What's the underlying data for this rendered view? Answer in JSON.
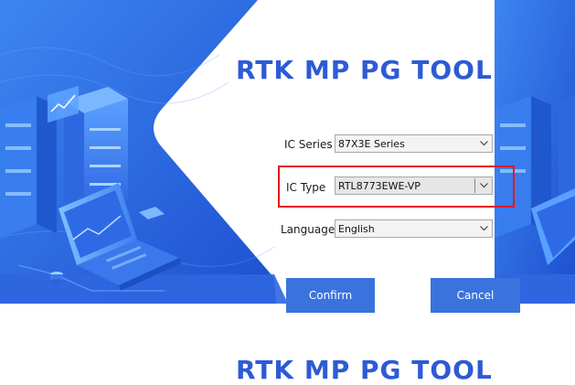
{
  "window": {
    "title": "RTK MP PG TOOL",
    "title_repeat": "RTK MP PG TOOL"
  },
  "form": {
    "ic_series": {
      "label": "IC Series",
      "value": "87X3E Series"
    },
    "ic_type": {
      "label": "IC Type",
      "value": "RTL8773EWE-VP"
    },
    "language": {
      "label": "Language",
      "value": "English"
    }
  },
  "buttons": {
    "confirm": "Confirm",
    "cancel": "Cancel"
  },
  "colors": {
    "accent": "#2d5bd6",
    "button": "#3a73de",
    "highlight": "#e3191b"
  }
}
